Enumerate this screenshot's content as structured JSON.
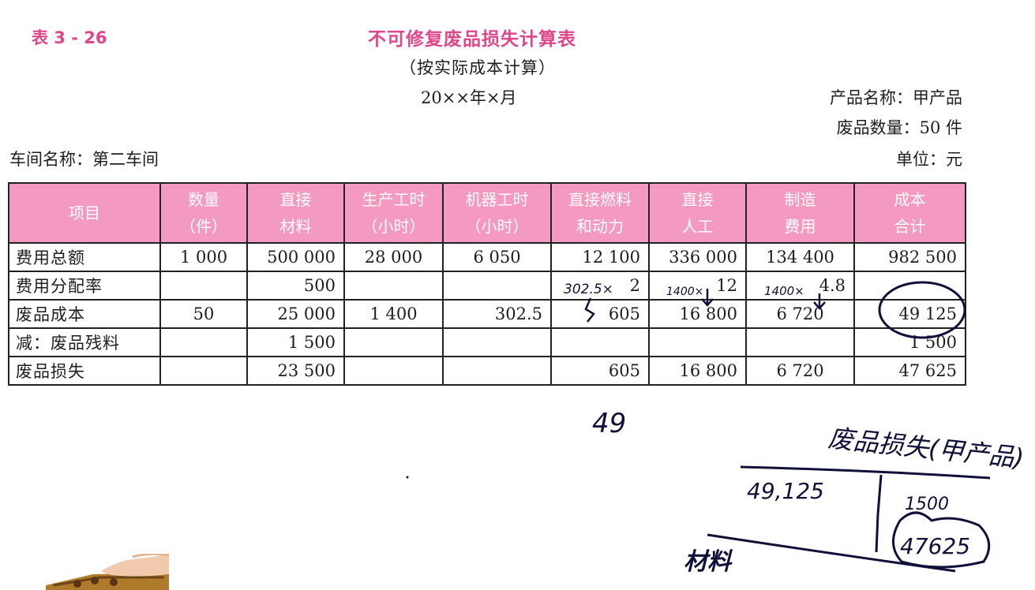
{
  "header": {
    "table_no": "表 3 - 26",
    "title": "不可修复废品损失计算表",
    "subtitle": "（按实际成本计算）",
    "date": "20××年×月",
    "product_name": "产品名称：甲产品",
    "scrap_qty": "废品数量：50 件",
    "workshop": "车间名称：第二车间",
    "unit": "单位：元"
  },
  "table": {
    "columns": [
      {
        "line1": "项目",
        "line2": ""
      },
      {
        "line1": "数量",
        "line2": "（件）"
      },
      {
        "line1": "直接",
        "line2": "材料"
      },
      {
        "line1": "生产工时",
        "line2": "（小时）"
      },
      {
        "line1": "机器工时",
        "line2": "（小时）"
      },
      {
        "line1": "直接燃料",
        "line2": "和动力"
      },
      {
        "line1": "直接",
        "line2": "人工"
      },
      {
        "line1": "制造",
        "line2": "费用"
      },
      {
        "line1": "成本",
        "line2": "合计"
      }
    ],
    "rows": [
      [
        "费用总额",
        "1 000",
        "500 000",
        "28 000",
        "6 050",
        "12 100",
        "336 000",
        "134 400",
        "982 500"
      ],
      [
        "费用分配率",
        "",
        "500",
        "",
        "",
        "2",
        "12",
        "4.8",
        ""
      ],
      [
        "废品成本",
        "50",
        "25 000",
        "1 400",
        "302.5",
        "605",
        "16 800",
        "6 720",
        "49 125"
      ],
      [
        "减：废品残料",
        "",
        "1 500",
        "",
        "",
        "",
        "",
        "",
        "1 500"
      ],
      [
        "废品损失",
        "",
        "23 500",
        "",
        "",
        "605",
        "16 800",
        "6 720",
        "47 625"
      ]
    ]
  },
  "annotations": {
    "note_fuel": "302.5×",
    "note_labor": "1400×",
    "note_overhead": "1400×",
    "note_49": "49",
    "t_account_title": "废品损失(甲产品)",
    "debit": "49,125",
    "credit": "1500",
    "credit_total": "47625",
    "bottom_note": "材料"
  }
}
